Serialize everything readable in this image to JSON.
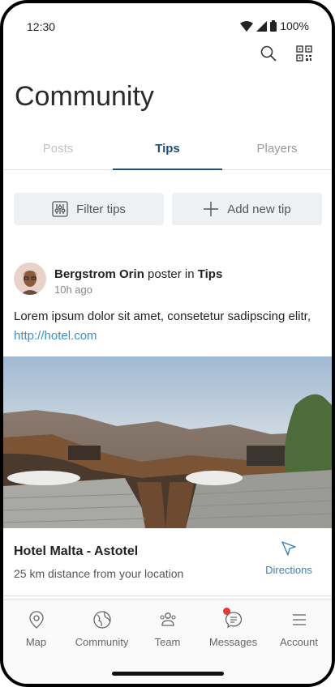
{
  "status_bar": {
    "time": "12:30",
    "battery": "100%"
  },
  "header": {
    "title": "Community"
  },
  "tabs": [
    {
      "label": "Posts"
    },
    {
      "label": "Tips"
    },
    {
      "label": "Players"
    }
  ],
  "actions": {
    "filter_label": "Filter tips",
    "add_label": "Add new tip"
  },
  "post": {
    "author": "Bergstrom Orin",
    "connector": "poster in",
    "category": "Tips",
    "time_ago": "10h ago",
    "text": "Lorem ipsum dolor sit amet, consetetur sadipscing elitr,",
    "link": "http://hotel.com"
  },
  "place": {
    "name": "Hotel Malta - Astotel",
    "distance": "25 km distance from your location",
    "directions_label": "Directions"
  },
  "nav": {
    "items": [
      {
        "label": "Map",
        "icon": "map-pin-icon"
      },
      {
        "label": "Community",
        "icon": "globe-icon"
      },
      {
        "label": "Team",
        "icon": "team-icon"
      },
      {
        "label": "Messages",
        "icon": "messages-icon"
      },
      {
        "label": "Account",
        "icon": "menu-icon"
      }
    ]
  },
  "colors": {
    "accent": "#1d4f7a",
    "link": "#3b8ed1",
    "badge": "#e53935"
  }
}
